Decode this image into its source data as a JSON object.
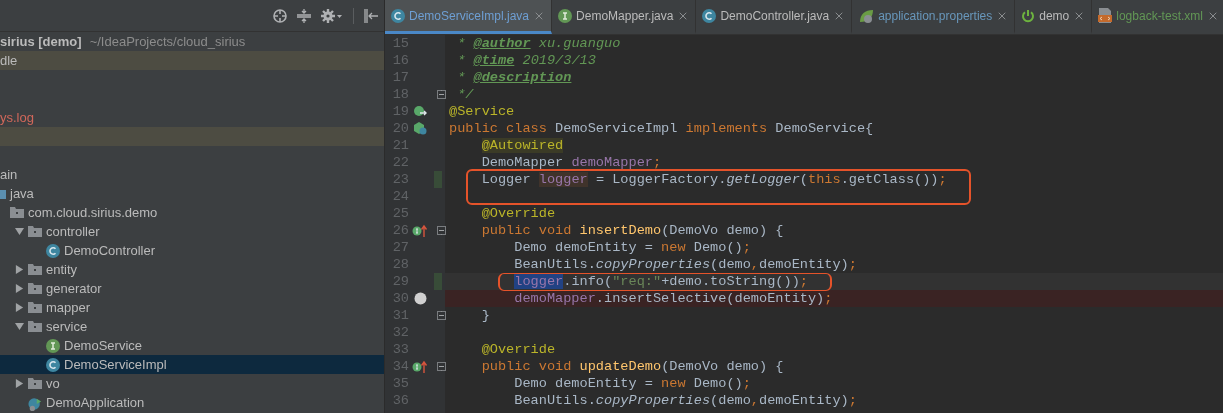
{
  "project_panel": {
    "toolbar": [
      {
        "kind": "locate"
      },
      {
        "kind": "collapse"
      },
      {
        "kind": "settings"
      },
      {
        "kind": "hide"
      }
    ],
    "items": [
      {
        "kind": "module",
        "label": "sirius [demo]",
        "path": "~/IdeaProjects/cloud_sirius",
        "color": "#bbbbbb",
        "selected": false
      },
      {
        "kind": "text",
        "label": "dle",
        "highlighted": true,
        "color": "#bbbbbb",
        "selected": false
      },
      {
        "kind": "blank",
        "selected": false
      },
      {
        "kind": "blank",
        "selected": false
      },
      {
        "kind": "text",
        "label": "ys.log",
        "color": "#d1675a",
        "selected": false
      },
      {
        "kind": "blank",
        "highlighted": true,
        "selected": false
      },
      {
        "kind": "blank",
        "selected": false
      },
      {
        "kind": "text",
        "label": "ain",
        "color": "#bbbbbb",
        "selected": false,
        "children": [
          {
            "kind": "source-folder",
            "label": "java",
            "selected": false,
            "children": [
              {
                "kind": "package",
                "label": "com.cloud.sirius.demo",
                "selected": false,
                "children": [
                  {
                    "kind": "package",
                    "label": "controller",
                    "expanded": true,
                    "selected": false,
                    "children": [
                      {
                        "kind": "class",
                        "label": "DemoController",
                        "selected": false
                      }
                    ]
                  },
                  {
                    "kind": "package",
                    "label": "entity",
                    "expanded": false,
                    "selected": false
                  },
                  {
                    "kind": "package",
                    "label": "generator",
                    "expanded": false,
                    "selected": false
                  },
                  {
                    "kind": "package",
                    "label": "mapper",
                    "expanded": false,
                    "selected": false
                  },
                  {
                    "kind": "package",
                    "label": "service",
                    "expanded": true,
                    "selected": false,
                    "children": [
                      {
                        "kind": "interface",
                        "label": "DemoService",
                        "selected": false
                      },
                      {
                        "kind": "class",
                        "label": "DemoServiceImpl",
                        "selected": true
                      }
                    ]
                  },
                  {
                    "kind": "package",
                    "label": "vo",
                    "expanded": false,
                    "selected": false
                  },
                  {
                    "kind": "app",
                    "label": "DemoApplication",
                    "selected": false
                  }
                ]
              }
            ]
          }
        ]
      }
    ]
  },
  "tabs": [
    {
      "label": "DemoServiceImpl.java",
      "kind": "class",
      "color": "#6e9fd4",
      "selected": true
    },
    {
      "label": "DemoMapper.java",
      "kind": "interface",
      "color": "#bbbbbb",
      "selected": false
    },
    {
      "label": "DemoController.java",
      "kind": "class",
      "color": "#bbbbbb",
      "selected": false
    },
    {
      "label": "application.properties",
      "kind": "properties",
      "color": "#6897bb",
      "selected": false
    },
    {
      "label": "demo",
      "kind": "spring-boot",
      "color": "#bbbbbb",
      "selected": false
    },
    {
      "label": "logback-test.xml",
      "kind": "xml",
      "color": "#629755",
      "selected": false
    }
  ],
  "editor": {
    "lines": [
      {
        "number": "15",
        "tokens": [
          {
            "text": " * ",
            "kind": "doc"
          },
          {
            "text": "@author",
            "kind": "doctag"
          },
          {
            "text": " xu.guanguo",
            "kind": "doc"
          }
        ]
      },
      {
        "number": "16",
        "tokens": [
          {
            "text": " * ",
            "kind": "doc"
          },
          {
            "text": "@time",
            "kind": "doctag"
          },
          {
            "text": " 2019/3/13",
            "kind": "doc"
          }
        ]
      },
      {
        "number": "17",
        "tokens": [
          {
            "text": " * ",
            "kind": "doc"
          },
          {
            "text": "@description",
            "kind": "doctag"
          }
        ]
      },
      {
        "number": "18",
        "fold_marker": {
          "kind": "end"
        },
        "tokens": [
          {
            "text": " */",
            "kind": "doc"
          }
        ]
      },
      {
        "number": "19",
        "gutter_marker": {
          "kind": "implemented"
        },
        "tokens": [
          {
            "text": "@Service",
            "kind": "annotation"
          }
        ]
      },
      {
        "number": "20",
        "gutter_marker": {
          "kind": "bean"
        },
        "tokens": [
          {
            "text": "public class ",
            "kind": "keyword"
          },
          {
            "text": "DemoServiceImpl ",
            "kind": "plain"
          },
          {
            "text": "implements ",
            "kind": "keyword"
          },
          {
            "text": "DemoService{",
            "kind": "plain"
          }
        ]
      },
      {
        "number": "21",
        "tokens": [
          {
            "text": "    @Autowired",
            "kind": "annotation",
            "highlight": {
              "kind": "warning"
            }
          }
        ]
      },
      {
        "number": "22",
        "tokens": [
          {
            "text": "    DemoMapper ",
            "kind": "plain"
          },
          {
            "text": "demoMapper",
            "kind": "field"
          },
          {
            "text": ";",
            "kind": "punct"
          }
        ]
      },
      {
        "number": "23",
        "changed": true,
        "boxed": true,
        "tokens": [
          {
            "text": "    Logger ",
            "kind": "plain"
          },
          {
            "text": "logger",
            "kind": "field",
            "highlight": {
              "kind": "usage"
            }
          },
          {
            "text": " = LoggerFactory.",
            "kind": "plain"
          },
          {
            "text": "getLogger",
            "kind": "static"
          },
          {
            "text": "(",
            "kind": "plain"
          },
          {
            "text": "this",
            "kind": "keyword"
          },
          {
            "text": ".getClass())",
            "kind": "plain"
          },
          {
            "text": ";",
            "kind": "punct"
          }
        ]
      },
      {
        "number": "24",
        "boxed": true
      },
      {
        "number": "25",
        "tokens": [
          {
            "text": "    @Override",
            "kind": "annotation"
          }
        ]
      },
      {
        "number": "26",
        "gutter_marker": {
          "kind": "overrides"
        },
        "fold_marker": {
          "kind": "start"
        },
        "tokens": [
          {
            "text": "    public void ",
            "kind": "keyword"
          },
          {
            "text": "insertDemo",
            "kind": "declaration"
          },
          {
            "text": "(DemoVo demo) {",
            "kind": "plain"
          }
        ]
      },
      {
        "number": "27",
        "tokens": [
          {
            "text": "        Demo demoEntity = ",
            "kind": "plain"
          },
          {
            "text": "new ",
            "kind": "keyword"
          },
          {
            "text": "Demo()",
            "kind": "plain"
          },
          {
            "text": ";",
            "kind": "punct"
          }
        ]
      },
      {
        "number": "28",
        "tokens": [
          {
            "text": "        BeanUtils.",
            "kind": "plain"
          },
          {
            "text": "copyProperties",
            "kind": "static"
          },
          {
            "text": "(demo",
            "kind": "plain"
          },
          {
            "text": ",",
            "kind": "punct"
          },
          {
            "text": "demoEntity)",
            "kind": "plain"
          },
          {
            "text": ";",
            "kind": "punct"
          }
        ]
      },
      {
        "number": "29",
        "changed": true,
        "caret": true,
        "boxed": true,
        "tokens": [
          {
            "text": "        logger",
            "kind": "field",
            "highlight": {
              "kind": "selection"
            }
          },
          {
            "text": ".info(",
            "kind": "plain"
          },
          {
            "text": "\"req:\"",
            "kind": "string"
          },
          {
            "text": "+demo.toString())",
            "kind": "plain"
          },
          {
            "text": ";",
            "kind": "punct"
          }
        ]
      },
      {
        "number": "30",
        "breakpoint": true,
        "tokens": [
          {
            "text": "        demoMapper",
            "kind": "field"
          },
          {
            "text": ".insertSelective(demoEntity)",
            "kind": "plain"
          },
          {
            "text": ";",
            "kind": "punct"
          }
        ]
      },
      {
        "number": "31",
        "fold_marker": {
          "kind": "end"
        },
        "tokens": [
          {
            "text": "    }",
            "kind": "plain"
          }
        ]
      },
      {
        "number": "32"
      },
      {
        "number": "33",
        "tokens": [
          {
            "text": "    @Override",
            "kind": "annotation"
          }
        ]
      },
      {
        "number": "34",
        "gutter_marker": {
          "kind": "overrides"
        },
        "fold_marker": {
          "kind": "start"
        },
        "tokens": [
          {
            "text": "    public void ",
            "kind": "keyword"
          },
          {
            "text": "updateDemo",
            "kind": "declaration"
          },
          {
            "text": "(DemoVo demo) {",
            "kind": "plain"
          }
        ]
      },
      {
        "number": "35",
        "tokens": [
          {
            "text": "        Demo demoEntity = ",
            "kind": "plain"
          },
          {
            "text": "new ",
            "kind": "keyword"
          },
          {
            "text": "Demo()",
            "kind": "plain"
          },
          {
            "text": ";",
            "kind": "punct"
          }
        ]
      },
      {
        "number": "36",
        "tokens": [
          {
            "text": "        BeanUtils.",
            "kind": "plain"
          },
          {
            "text": "copyProperties",
            "kind": "static"
          },
          {
            "text": "(demo",
            "kind": "plain"
          },
          {
            "text": ",",
            "kind": "punct"
          },
          {
            "text": "demoEntity)",
            "kind": "plain"
          },
          {
            "text": ";",
            "kind": "punct"
          }
        ]
      }
    ]
  }
}
